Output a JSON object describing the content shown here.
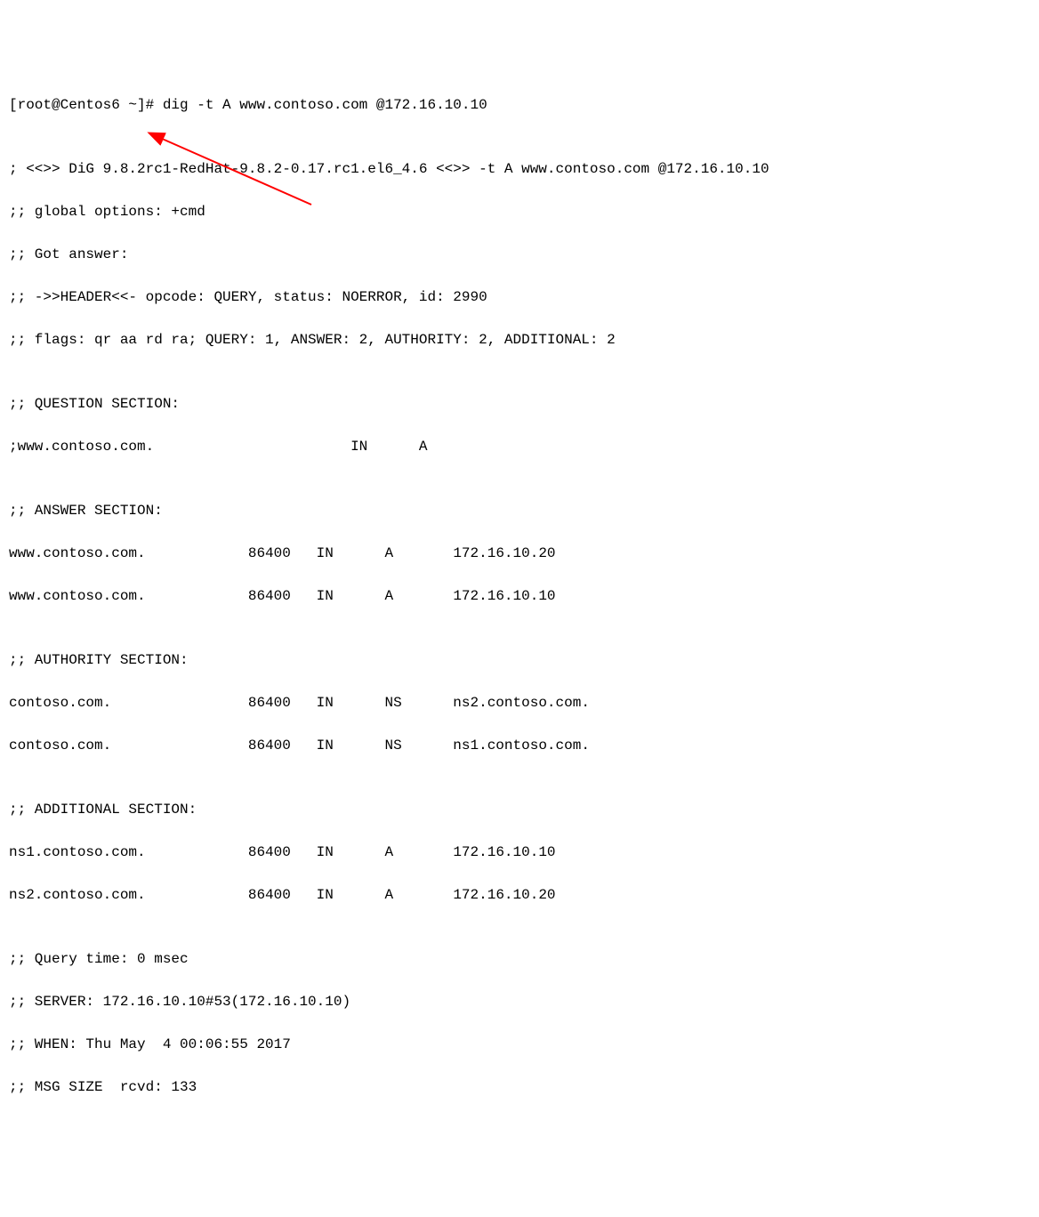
{
  "prompt": "[root@Centos6 ~]# ",
  "command": "dig -t A www.contoso.com @172.16.10.10",
  "banner": "; <<>> DiG 9.8.2rc1-RedHat-9.8.2-0.17.rc1.el6_4.6 <<>> -t A www.contoso.com @172.16.10.10",
  "globalOptions": ";; global options: +cmd",
  "gotAnswer": ";; Got answer:",
  "header": ";; ->>HEADER<<- opcode: QUERY, status: NOERROR, id: 2990",
  "flags": ";; flags: qr aa rd ra; QUERY: 1, ANSWER: 2, AUTHORITY: 2, ADDITIONAL: 2",
  "questionHeader": ";; QUESTION SECTION:",
  "question": {
    "name": ";www.contoso.com.",
    "class": "IN",
    "type": "A"
  },
  "answerHeader": ";; ANSWER SECTION:",
  "answers": [
    {
      "name": "www.contoso.com.",
      "ttl": "86400",
      "class": "IN",
      "type": "A",
      "value": "172.16.10.20"
    },
    {
      "name": "www.contoso.com.",
      "ttl": "86400",
      "class": "IN",
      "type": "A",
      "value": "172.16.10.10"
    }
  ],
  "authorityHeader": ";; AUTHORITY SECTION:",
  "authority": [
    {
      "name": "contoso.com.",
      "ttl": "86400",
      "class": "IN",
      "type": "NS",
      "value": "ns2.contoso.com."
    },
    {
      "name": "contoso.com.",
      "ttl": "86400",
      "class": "IN",
      "type": "NS",
      "value": "ns1.contoso.com."
    }
  ],
  "additionalHeader": ";; ADDITIONAL SECTION:",
  "additional": [
    {
      "name": "ns1.contoso.com.",
      "ttl": "86400",
      "class": "IN",
      "type": "A",
      "value": "172.16.10.10"
    },
    {
      "name": "ns2.contoso.com.",
      "ttl": "86400",
      "class": "IN",
      "type": "A",
      "value": "172.16.10.20"
    }
  ],
  "queryTime": ";; Query time: 0 msec",
  "server": ";; SERVER: 172.16.10.10#53(172.16.10.10)",
  "when": ";; WHEN: Thu May  4 00:06:55 2017",
  "msgSize": ";; MSG SIZE  rcvd: 133",
  "arrow": {
    "color": "#ff0000"
  }
}
